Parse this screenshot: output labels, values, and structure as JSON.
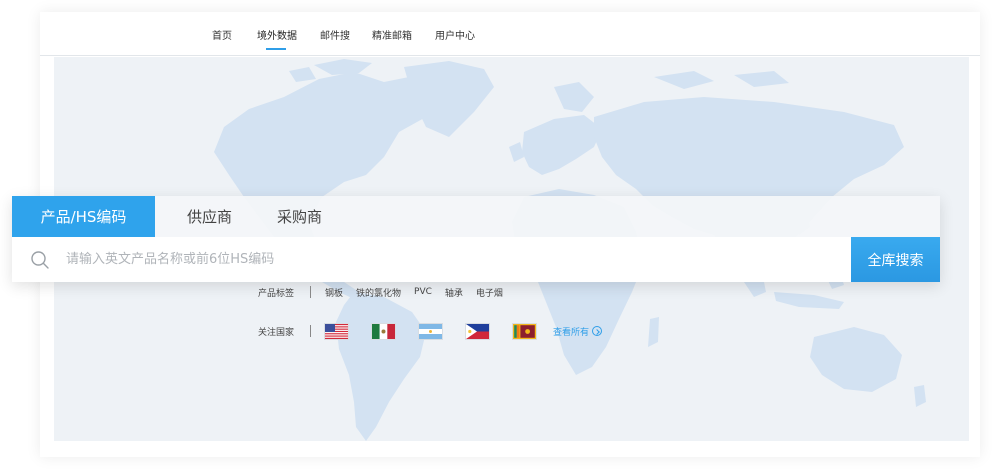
{
  "nav": {
    "items": [
      {
        "label": "首页"
      },
      {
        "label": "境外数据"
      },
      {
        "label": "邮件搜"
      },
      {
        "label": "精准邮箱"
      },
      {
        "label": "用户中心"
      }
    ],
    "active_index": 1
  },
  "search": {
    "tabs": [
      {
        "label": "产品/HS编码"
      },
      {
        "label": "供应商"
      },
      {
        "label": "采购商"
      }
    ],
    "active_tab": 0,
    "placeholder": "请输入英文产品名称或前6位HS编码",
    "value": "",
    "button_label": "全库搜索"
  },
  "tags": {
    "label": "产品标签",
    "items": [
      "钢板",
      "铁的氯化物",
      "PVC",
      "轴承",
      "电子烟"
    ]
  },
  "countries": {
    "label": "关注国家",
    "flags": [
      "us-flag",
      "mexico-flag",
      "argentina-flag",
      "philippines-flag",
      "sri-lanka-flag"
    ],
    "view_all_label": "查看所有"
  },
  "colors": {
    "accent": "#2fa3ec",
    "map_background": "#eef2f6",
    "map_land": "#d3e2f2"
  }
}
